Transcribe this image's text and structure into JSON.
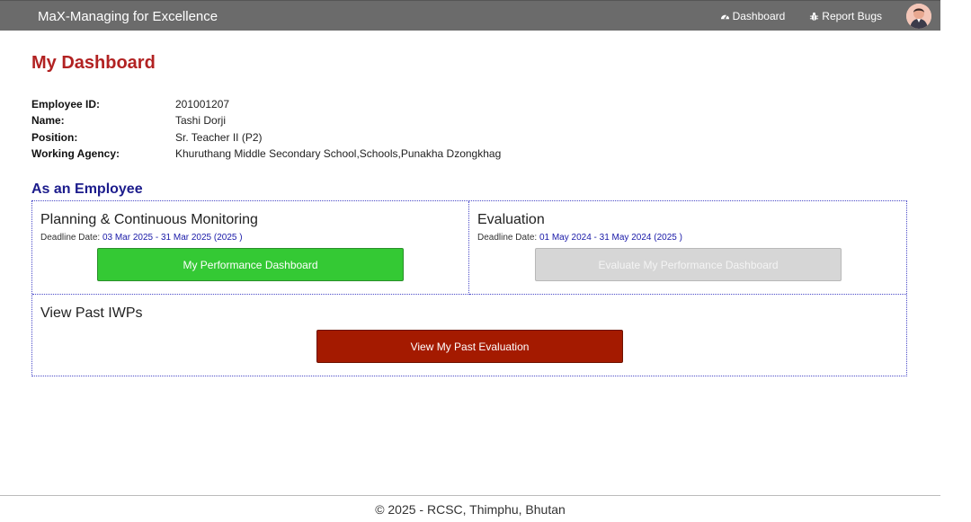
{
  "navbar": {
    "brand": "MaX-Managing for Excellence",
    "links": [
      {
        "label": "Dashboard",
        "icon": "dashboard-icon"
      },
      {
        "label": "Report Bugs",
        "icon": "bug-icon"
      }
    ],
    "avatar_icon": "user-avatar"
  },
  "page": {
    "title": "My Dashboard"
  },
  "employee": {
    "id_label": "Employee ID:",
    "id_value": "201001207",
    "name_label": "Name:",
    "name_value": "Tashi Dorji",
    "position_label": "Position:",
    "position_value": "Sr. Teacher II (P2)",
    "agency_label": "Working Agency:",
    "agency_value": "Khuruthang Middle Secondary School,Schools,Punakha Dzongkhag"
  },
  "section": {
    "title": "As an Employee"
  },
  "planning": {
    "title": "Planning & Continuous Monitoring",
    "deadline_label": "Deadline Date: ",
    "deadline_value": "03 Mar 2025 - 31 Mar 2025 (2025 )",
    "button": "My Performance Dashboard"
  },
  "evaluation": {
    "title": "Evaluation",
    "deadline_label": "Deadline Date: ",
    "deadline_value": "01 May 2024 - 31 May 2024 (2025 )",
    "button": "Evaluate My Performance Dashboard"
  },
  "past": {
    "title": "View Past IWPs",
    "button": "View My Past Evaluation"
  },
  "footer": {
    "text": "© 2025 - RCSC, Thimphu, Bhutan"
  },
  "colors": {
    "navbar": "#6b6b6b",
    "title": "#b22222",
    "section": "#1c1c8c",
    "green_button": "#34c934",
    "grey_button": "#d6d6d6",
    "red_button": "#a41a00"
  }
}
